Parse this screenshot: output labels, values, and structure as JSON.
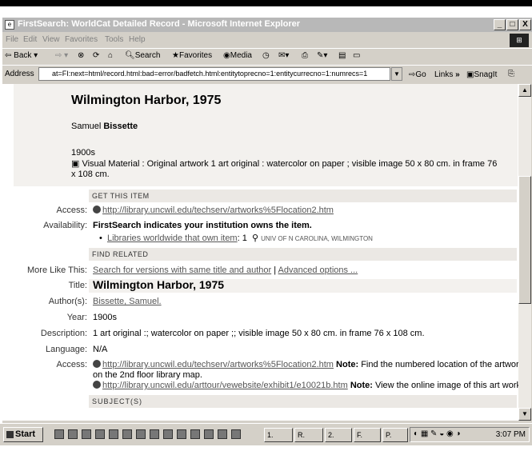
{
  "window": {
    "title": "FirstSearch: WorldCat Detailed Record - Microsoft Internet Explorer",
    "controls": [
      "_",
      "□",
      "X"
    ]
  },
  "menu": [
    "File",
    "Edit",
    "View",
    "Favorites",
    "Tools",
    "Help"
  ],
  "toolbar": {
    "back": "Back",
    "search": "Search",
    "favorites": "Favorites",
    "media": "Media"
  },
  "address": {
    "label": "Address",
    "url": "at=FI:next=html/record.html:bad=error/badfetch.html:entitytoprecno=1:entitycurrecno=1:numrecs=1",
    "go": "Go",
    "links": "Links",
    "chevron": "»",
    "snagit": "SnagIt"
  },
  "record": {
    "title": "Wilmington Harbor, 1975",
    "author_first": "Samuel",
    "author_last": "Bissette",
    "year": "1900s",
    "format": "Visual Material : Original artwork 1 art original : watercolor on paper ; visible image 50 x 80 cm. in frame 76 x 108 cm."
  },
  "sections": {
    "get_item": "Get This Item",
    "find_related": "Find Related",
    "subjects": "SUBJECT(S)"
  },
  "labels": {
    "access": "Access:",
    "availability": "Availability:",
    "more_like": "More Like This:",
    "title": "Title:",
    "authors": "Author(s):",
    "year": "Year:",
    "description": "Description:",
    "language": "Language:",
    "access2": "Access:"
  },
  "values": {
    "access_url": "http://library.uncwil.edu/techserv/artworks%5Flocation2.htm",
    "availability": "FirstSearch indicates your institution owns the item.",
    "libraries_link": "Libraries worldwide that own item",
    "libraries_count": ": 1",
    "library_name": "UNIV OF N CAROLINA, WILMINGTON",
    "more_like_link1": "Search for versions with same title and author",
    "more_like_sep": " | ",
    "more_like_link2": "Advanced options ...",
    "title": "Wilmington Harbor, 1975",
    "author": "Bissette, Samuel.",
    "year": "1900s",
    "description": "1 art original :; watercolor on paper ;; visible image 50 x 80 cm. in frame 76 x 108 cm.",
    "language": "N/A",
    "access2_url1": "http://library.uncwil.edu/techserv/artworks%5Flocation2.htm",
    "note_label": "Note:",
    "access2_note1": " Find the numbered location of the artwork",
    "access2_note1b": "on the 2nd floor library map.",
    "access2_url2": "http://library.uncwil.edu/arttour/vewebsite/exhibit1/e10021b.htm",
    "access2_note2": " View the online image of this art work"
  },
  "taskbar": {
    "start": "Start",
    "buttons": [
      "1.",
      "R.",
      "2.",
      "F.",
      "P."
    ],
    "clock": "3:07 PM"
  }
}
